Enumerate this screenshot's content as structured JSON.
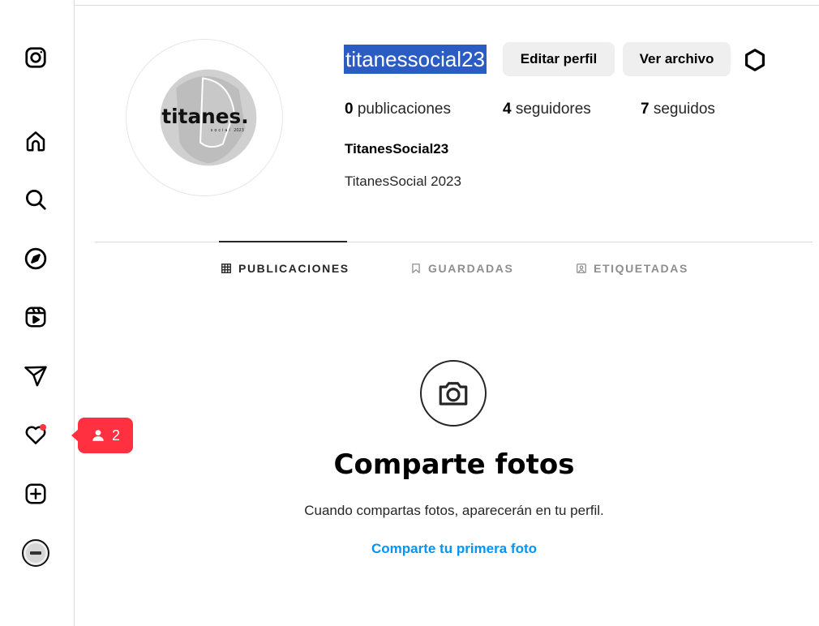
{
  "sidebar": {
    "icons": [
      "instagram-logo-icon",
      "home-icon",
      "search-icon",
      "explore-icon",
      "reels-icon",
      "messages-icon",
      "notifications-heart-icon",
      "create-icon",
      "profile-avatar"
    ]
  },
  "notification_tooltip": {
    "icon": "person-icon",
    "count": "2",
    "color": "#ff3040"
  },
  "profile": {
    "logo_text": "titanes.",
    "logo_subtext": "social",
    "logo_year": "2023",
    "username": "titanessocial23",
    "edit_button": "Editar perfil",
    "archive_button": "Ver archivo",
    "stats": {
      "posts_count": "0",
      "posts_label": "publicaciones",
      "followers_count": "4",
      "followers_label": "seguidores",
      "following_count": "7",
      "following_label": "seguidos"
    },
    "full_name": "TitanesSocial23",
    "bio": "TitanesSocial 2023"
  },
  "tabs": [
    {
      "label": "PUBLICACIONES",
      "icon": "grid-icon",
      "active": true
    },
    {
      "label": "GUARDADAS",
      "icon": "bookmark-icon",
      "active": false
    },
    {
      "label": "ETIQUETADAS",
      "icon": "tagged-icon",
      "active": false
    }
  ],
  "empty_state": {
    "icon": "camera-icon",
    "title": "Comparte fotos",
    "subtitle": "Cuando compartas fotos, aparecerán en tu perfil.",
    "link": "Comparte tu primera foto"
  },
  "colors": {
    "accent_link": "#0095f6",
    "selection_highlight": "#2a5cc4",
    "notification": "#ff3040",
    "button_bg": "#efefef"
  }
}
